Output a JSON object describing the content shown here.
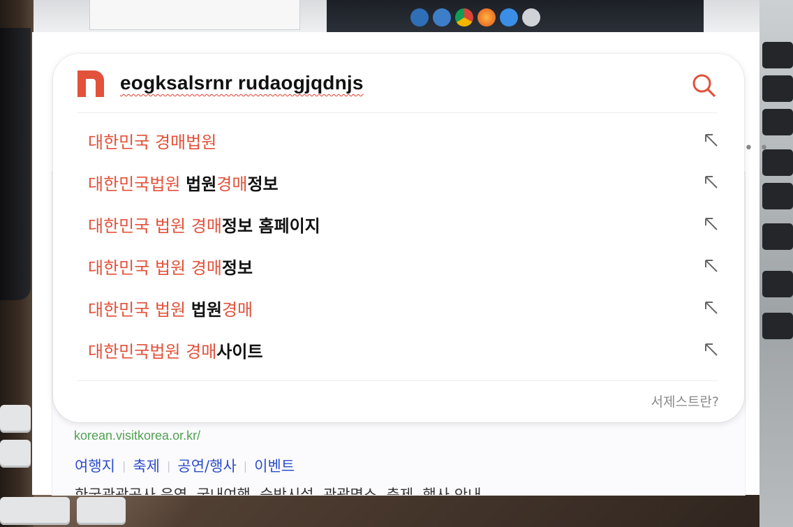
{
  "search": {
    "query": "eogksalsrnr rudaogjqdnjs",
    "search_icon": "search-icon",
    "brand_color": "#e2513a"
  },
  "logo": {
    "icon": "naver-n-logo",
    "color": "#e2513a"
  },
  "suggestions": [
    {
      "highlight": "대한민국 경매법원",
      "rest": ""
    },
    {
      "highlight": "대한민국법원 ",
      "rest": "법원",
      "highlight2": "경매",
      "rest2": "정보"
    },
    {
      "highlight": "대한민국 법원 경매",
      "rest": "정보 홈페이지"
    },
    {
      "highlight": "대한민국 법원 경매",
      "rest": "정보"
    },
    {
      "highlight": "대한민국 법원 ",
      "rest": "법원",
      "highlight2": "경매",
      "rest2": ""
    },
    {
      "highlight": "대한민국법원 경매",
      "rest": "사이트"
    }
  ],
  "fill_icon": "arrow-up-left-icon",
  "help_link": "서제스트란?",
  "result": {
    "url": "korean.visitkorea.or.kr/",
    "links": [
      "여행지",
      "축제",
      "공연/행사",
      "이벤트"
    ],
    "snippet": "한국관광공사 운영, 국내여행, 숙박시설, 관광명소, 축제, 행사 안내"
  },
  "page_more": "• •"
}
